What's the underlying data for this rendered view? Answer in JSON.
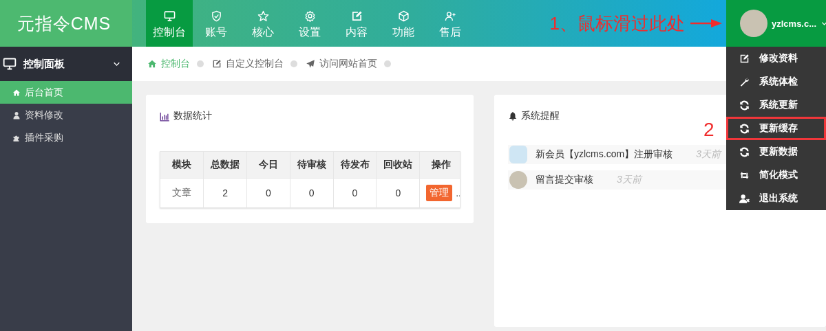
{
  "logo": "元指令CMS",
  "nav": [
    {
      "label": "控制台",
      "selected": true
    },
    {
      "label": "账号",
      "selected": false
    },
    {
      "label": "核心",
      "selected": false
    },
    {
      "label": "设置",
      "selected": false
    },
    {
      "label": "内容",
      "selected": false
    },
    {
      "label": "功能",
      "selected": false
    },
    {
      "label": "售后",
      "selected": false
    }
  ],
  "annotations": [
    {
      "kind": "arrow",
      "text": "1、鼠标滑过此处"
    },
    {
      "kind": "label",
      "text": "2"
    }
  ],
  "user": {
    "name": "yzlcms.c...",
    "expanded": true
  },
  "user_menu": [
    {
      "label": "修改资料",
      "highlighted": false
    },
    {
      "label": "系统体检",
      "highlighted": false
    },
    {
      "label": "系统更新",
      "highlighted": false
    },
    {
      "label": "更新缓存",
      "highlighted": true
    },
    {
      "label": "更新数据",
      "highlighted": false
    },
    {
      "label": "简化模式",
      "highlighted": false
    },
    {
      "label": "退出系统",
      "highlighted": false
    }
  ],
  "sidebar": {
    "title": "控制面板",
    "expanded": true,
    "items": [
      {
        "label": "后台首页",
        "selected": true
      },
      {
        "label": "资料修改",
        "selected": false
      },
      {
        "label": "插件采购",
        "selected": false
      }
    ]
  },
  "breadcrumbs": [
    {
      "label": "控制台",
      "selected": true
    },
    {
      "label": "自定义控制台",
      "selected": false
    },
    {
      "label": "访问网站首页",
      "selected": false
    }
  ],
  "stats_card": {
    "title": "数据统计",
    "columns": [
      "模块",
      "总数据",
      "今日",
      "待审核",
      "待发布",
      "回收站",
      "操作"
    ],
    "rows": [
      {
        "cells": [
          "文章",
          "2",
          "0",
          "0",
          "0",
          "0"
        ],
        "action": "管理",
        "overflow": ".."
      }
    ]
  },
  "notice_card": {
    "title": "系统提醒",
    "items": [
      {
        "kind": "icon",
        "text": "新会员【yzlcms.com】注册审核",
        "time": "3天前"
      },
      {
        "kind": "photo",
        "text": "留言提交审核",
        "time": "3天前"
      }
    ]
  }
}
